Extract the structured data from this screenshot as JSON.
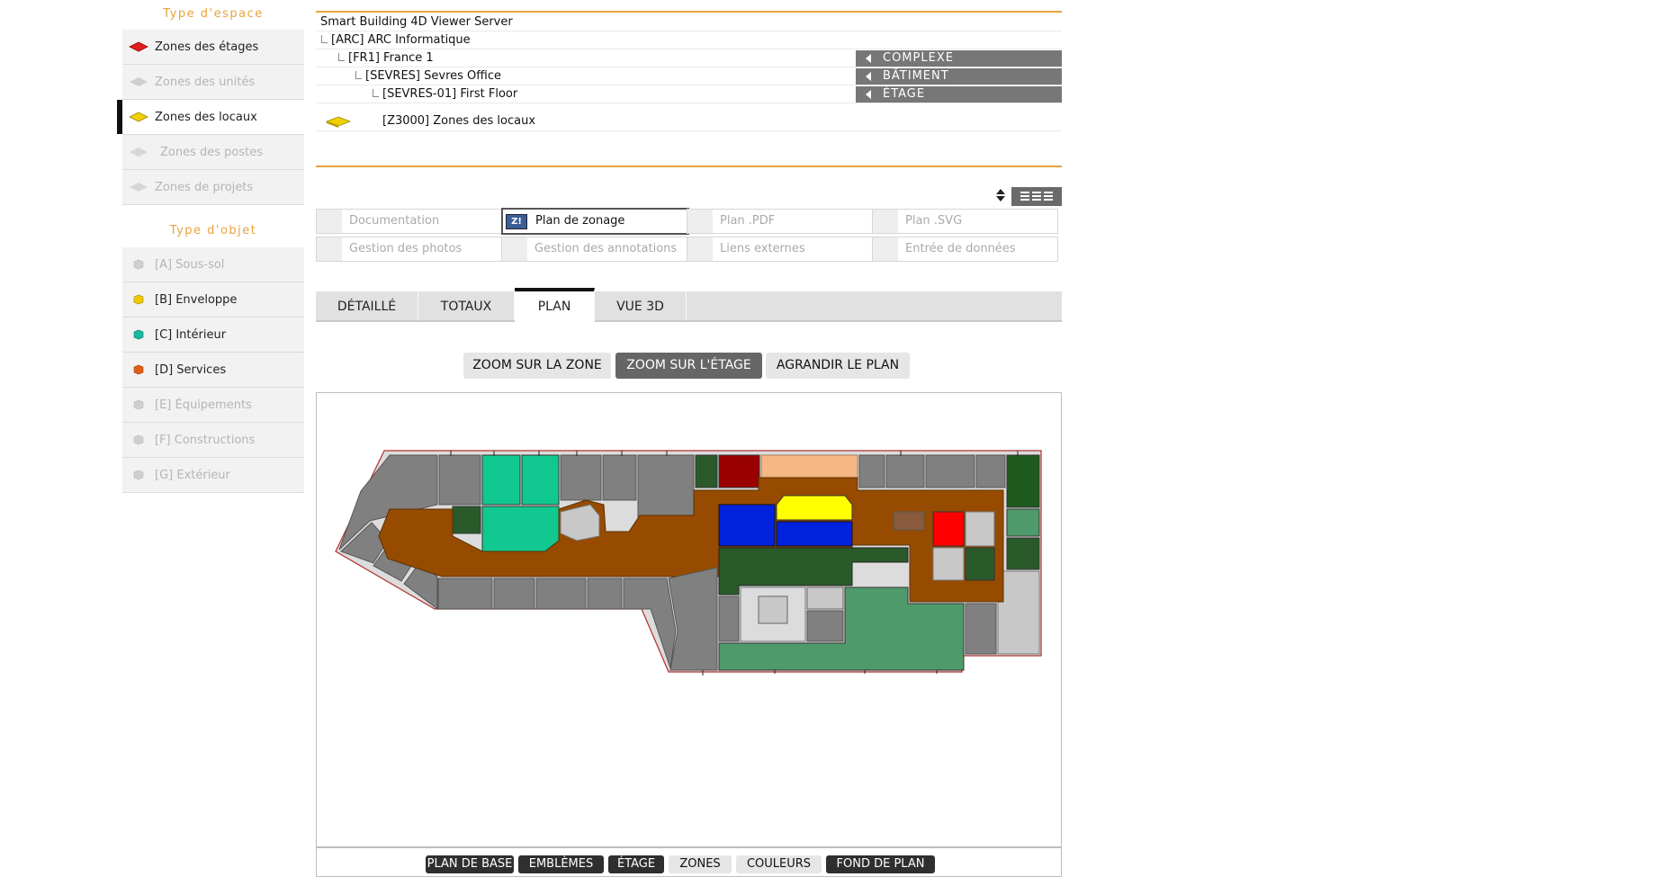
{
  "sidebar": {
    "space_title": "Type d'espace",
    "space_items": [
      {
        "label": "Zones des étages",
        "icon": "red-layer-icon",
        "color": "#e02020",
        "state": "normal"
      },
      {
        "label": "Zones des unités",
        "icon": "gray-layer-icon",
        "color": "#c8c8c8",
        "state": "disabled"
      },
      {
        "label": "Zones des locaux",
        "icon": "yellow-layer-icon",
        "color": "#f0d000",
        "state": "active"
      },
      {
        "label": "Zones des postes",
        "icon": "gray-layer-icon",
        "color": "#d0d0d0",
        "state": "disabled"
      },
      {
        "label": "Zones de projets",
        "icon": "gray-layer-icon",
        "color": "#d0d0d0",
        "state": "disabled"
      }
    ],
    "object_title": "Type d'objet",
    "object_items": [
      {
        "label": "[A] Sous-sol",
        "icon": "gray-cube-icon",
        "color": "#c8c8c8",
        "state": "disabled"
      },
      {
        "label": "[B] Enveloppe",
        "icon": "yellow-cube-icon",
        "color": "#f0c800",
        "state": "normal"
      },
      {
        "label": "[C] Intérieur",
        "icon": "teal-cube-icon",
        "color": "#19b8a0",
        "state": "normal"
      },
      {
        "label": "[D] Services",
        "icon": "orange-cube-icon",
        "color": "#e0601a",
        "state": "normal"
      },
      {
        "label": "[E] Équipements",
        "icon": "gray-cube-icon",
        "color": "#c8c8c8",
        "state": "disabled"
      },
      {
        "label": "[F] Constructions",
        "icon": "gray-cube-icon",
        "color": "#c8c8c8",
        "state": "disabled"
      },
      {
        "label": "[G] Extérieur",
        "icon": "gray-cube-icon",
        "color": "#c8c8c8",
        "state": "disabled"
      }
    ]
  },
  "tree": {
    "server": "Smart Building 4D Viewer Server",
    "org": "[ARC] ARC Informatique",
    "complex": "[FR1] France 1",
    "building": "[SEVRES] Sevres Office",
    "floor": "[SEVRES-01] First Floor",
    "zone": "[Z3000] Zones des locaux",
    "zone_icon": "yellow-layer-icon",
    "zone_color": "#f0d000"
  },
  "nav": {
    "complexe": "COMPLEXE",
    "batiment": "BÂTIMENT",
    "etage": "ÉTAGE"
  },
  "docs": {
    "row1": [
      {
        "label": "Documentation",
        "active": false
      },
      {
        "label": "Plan de zonage",
        "active": true,
        "icon_text": "Z!"
      },
      {
        "label": "Plan .PDF",
        "active": false
      },
      {
        "label": "Plan .SVG",
        "active": false
      }
    ],
    "row2": [
      {
        "label": "Gestion des photos",
        "active": false
      },
      {
        "label": "Gestion des annotations",
        "active": false
      },
      {
        "label": "Liens externes",
        "active": false
      },
      {
        "label": "Entrée de données",
        "active": false
      }
    ]
  },
  "tabs": {
    "detaille": "DÉTAILLÉ",
    "totaux": "TOTAUX",
    "plan": "PLAN",
    "vue3d": "VUE 3D",
    "active": "PLAN"
  },
  "zoom": {
    "zone": "ZOOM SUR LA ZONE",
    "etage": "ZOOM SUR L'ÉTAGE",
    "agrandir": "AGRANDIR LE PLAN",
    "active": "ZOOM SUR L'ÉTAGE"
  },
  "layers": {
    "base": "PLAN DE BASE",
    "emblemes": "EMBLÈMES",
    "etage": "ÉTAGE",
    "zones": "ZONES",
    "couleurs": "COULEURS",
    "fond": "FOND DE PLAN"
  },
  "colors": {
    "accent": "#e8a33c",
    "corridor": "#964b00",
    "room_gray": "#808080",
    "light_gray": "#c8c8c8",
    "teal": "#10c890",
    "dark_green": "#2a5a2a",
    "medium_green": "#4f9a6a",
    "blue": "#0022dd",
    "yellow": "#ffff00",
    "red": "#ff0000",
    "dark_red": "#990000",
    "peach": "#f5b885",
    "brown": "#8a5a3c"
  }
}
